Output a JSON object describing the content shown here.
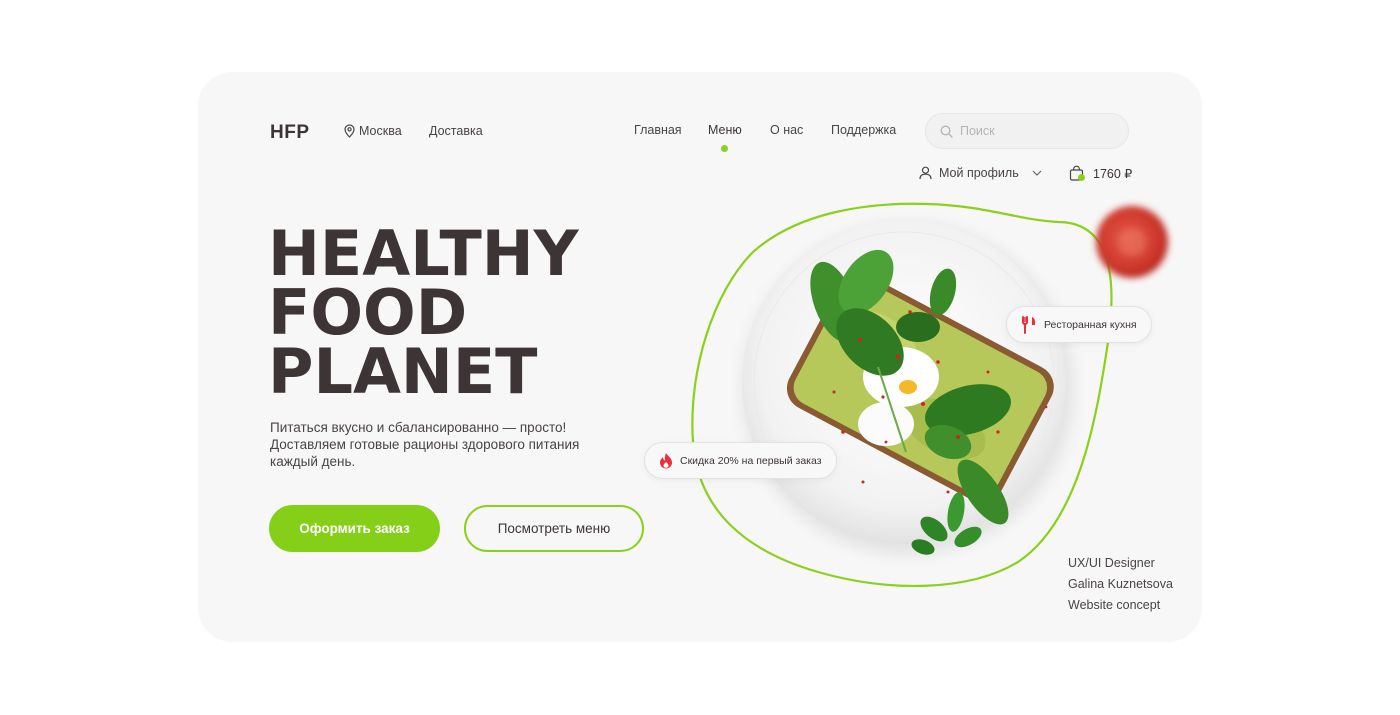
{
  "header": {
    "logo": "HFP",
    "location": "Москва",
    "delivery": "Доставка",
    "nav": [
      "Главная",
      "Меню",
      "О нас",
      "Поддержка"
    ],
    "active_nav": "Меню",
    "search_placeholder": "Поиск",
    "profile": "Мой профиль",
    "cart_total": "1760 ₽"
  },
  "hero": {
    "title_lines": [
      "HEALTHY",
      "FOOD",
      "PLANET"
    ],
    "subtitle": "Питаться вкусно и сбалансированно — просто! Доставляем готовые рационы здорового питания каждый день.",
    "primary_button": "Оформить заказ",
    "secondary_button": "Посмотреть меню"
  },
  "badges": {
    "restaurant": "Ресторанная кухня",
    "discount": "Скидка 20% на первый заказ"
  },
  "credits": [
    "UX/UI Designer",
    "Galina Kuznetsova",
    "Website concept"
  ],
  "colors": {
    "accent": "#8ad11b",
    "text": "#3d3535",
    "card_bg": "#f7f7f7",
    "badge_icon": "#e8303a"
  },
  "icons": [
    "location-pin-icon",
    "search-icon",
    "user-icon",
    "chevron-down-icon",
    "shopping-bag-icon",
    "fork-knife-icon",
    "fire-icon"
  ]
}
